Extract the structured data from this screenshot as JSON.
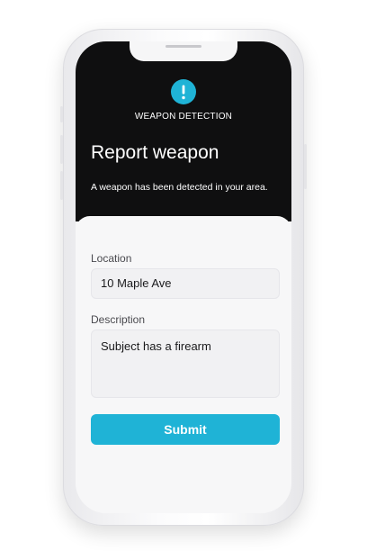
{
  "header": {
    "icon": "exclamation-icon",
    "caption": "WEAPON DETECTION",
    "title": "Report weapon",
    "subtitle": "A weapon has been detected in your area."
  },
  "form": {
    "location_label": "Location",
    "location_value": "10 Maple Ave",
    "description_label": "Description",
    "description_value": "Subject has a firearm",
    "submit_label": "Submit"
  },
  "colors": {
    "accent": "#1fb3d6",
    "header_bg": "#0f0f10",
    "sheet_bg": "#f7f7f8"
  }
}
